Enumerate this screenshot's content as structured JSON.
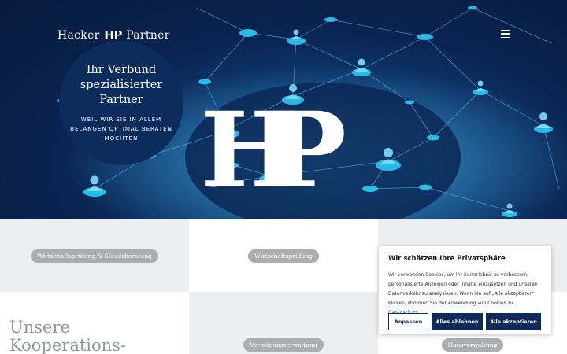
{
  "header": {
    "logo_left": "Hacker",
    "logo_mark": "HP",
    "logo_right": "Partner",
    "menu_icon": "hamburger-icon"
  },
  "hero": {
    "title": "Ihr Verbund spezialisierter Partner",
    "subtitle": "WEIL WIR SIE IN ALLEM BELANGEN OPTIMAL BERATEN MÖCHTEN",
    "big_mark": "HP"
  },
  "tiles": [
    {
      "label": "Wirtschaftsprüfung & Steuerberatung"
    },
    {
      "label": "Wirtschaftsprüfung"
    },
    {
      "label": ""
    },
    {
      "label": ""
    },
    {
      "label": "Vermögensverwaltung"
    },
    {
      "label": "Hausverwaltung"
    }
  ],
  "cooperation": {
    "line1": "Unsere",
    "line2": "Kooperations-"
  },
  "cookie": {
    "title": "Wir schätzen Ihre Privatsphäre",
    "text": "Wir verwenden Cookies, um Ihr Surferlebnis zu verbessern, personalisierte Anzeigen oder Inhalte einzusetzen und unseren Datenverkehr zu analysieren. Wenn Sie auf „Alle akzeptieren“ klicken, stimmen Sie der Anwendung von Cookies zu.",
    "link": "Datenschutz",
    "btn_customize": "Anpassen",
    "btn_reject": "Alles ablehnen",
    "btn_accept": "Alle akzeptieren"
  },
  "colors": {
    "brand_navy": "#0f2b5b",
    "hero_blue": "#0a2350",
    "node_cyan": "#29c4ef",
    "pill_gray": "#a9aeb2"
  }
}
